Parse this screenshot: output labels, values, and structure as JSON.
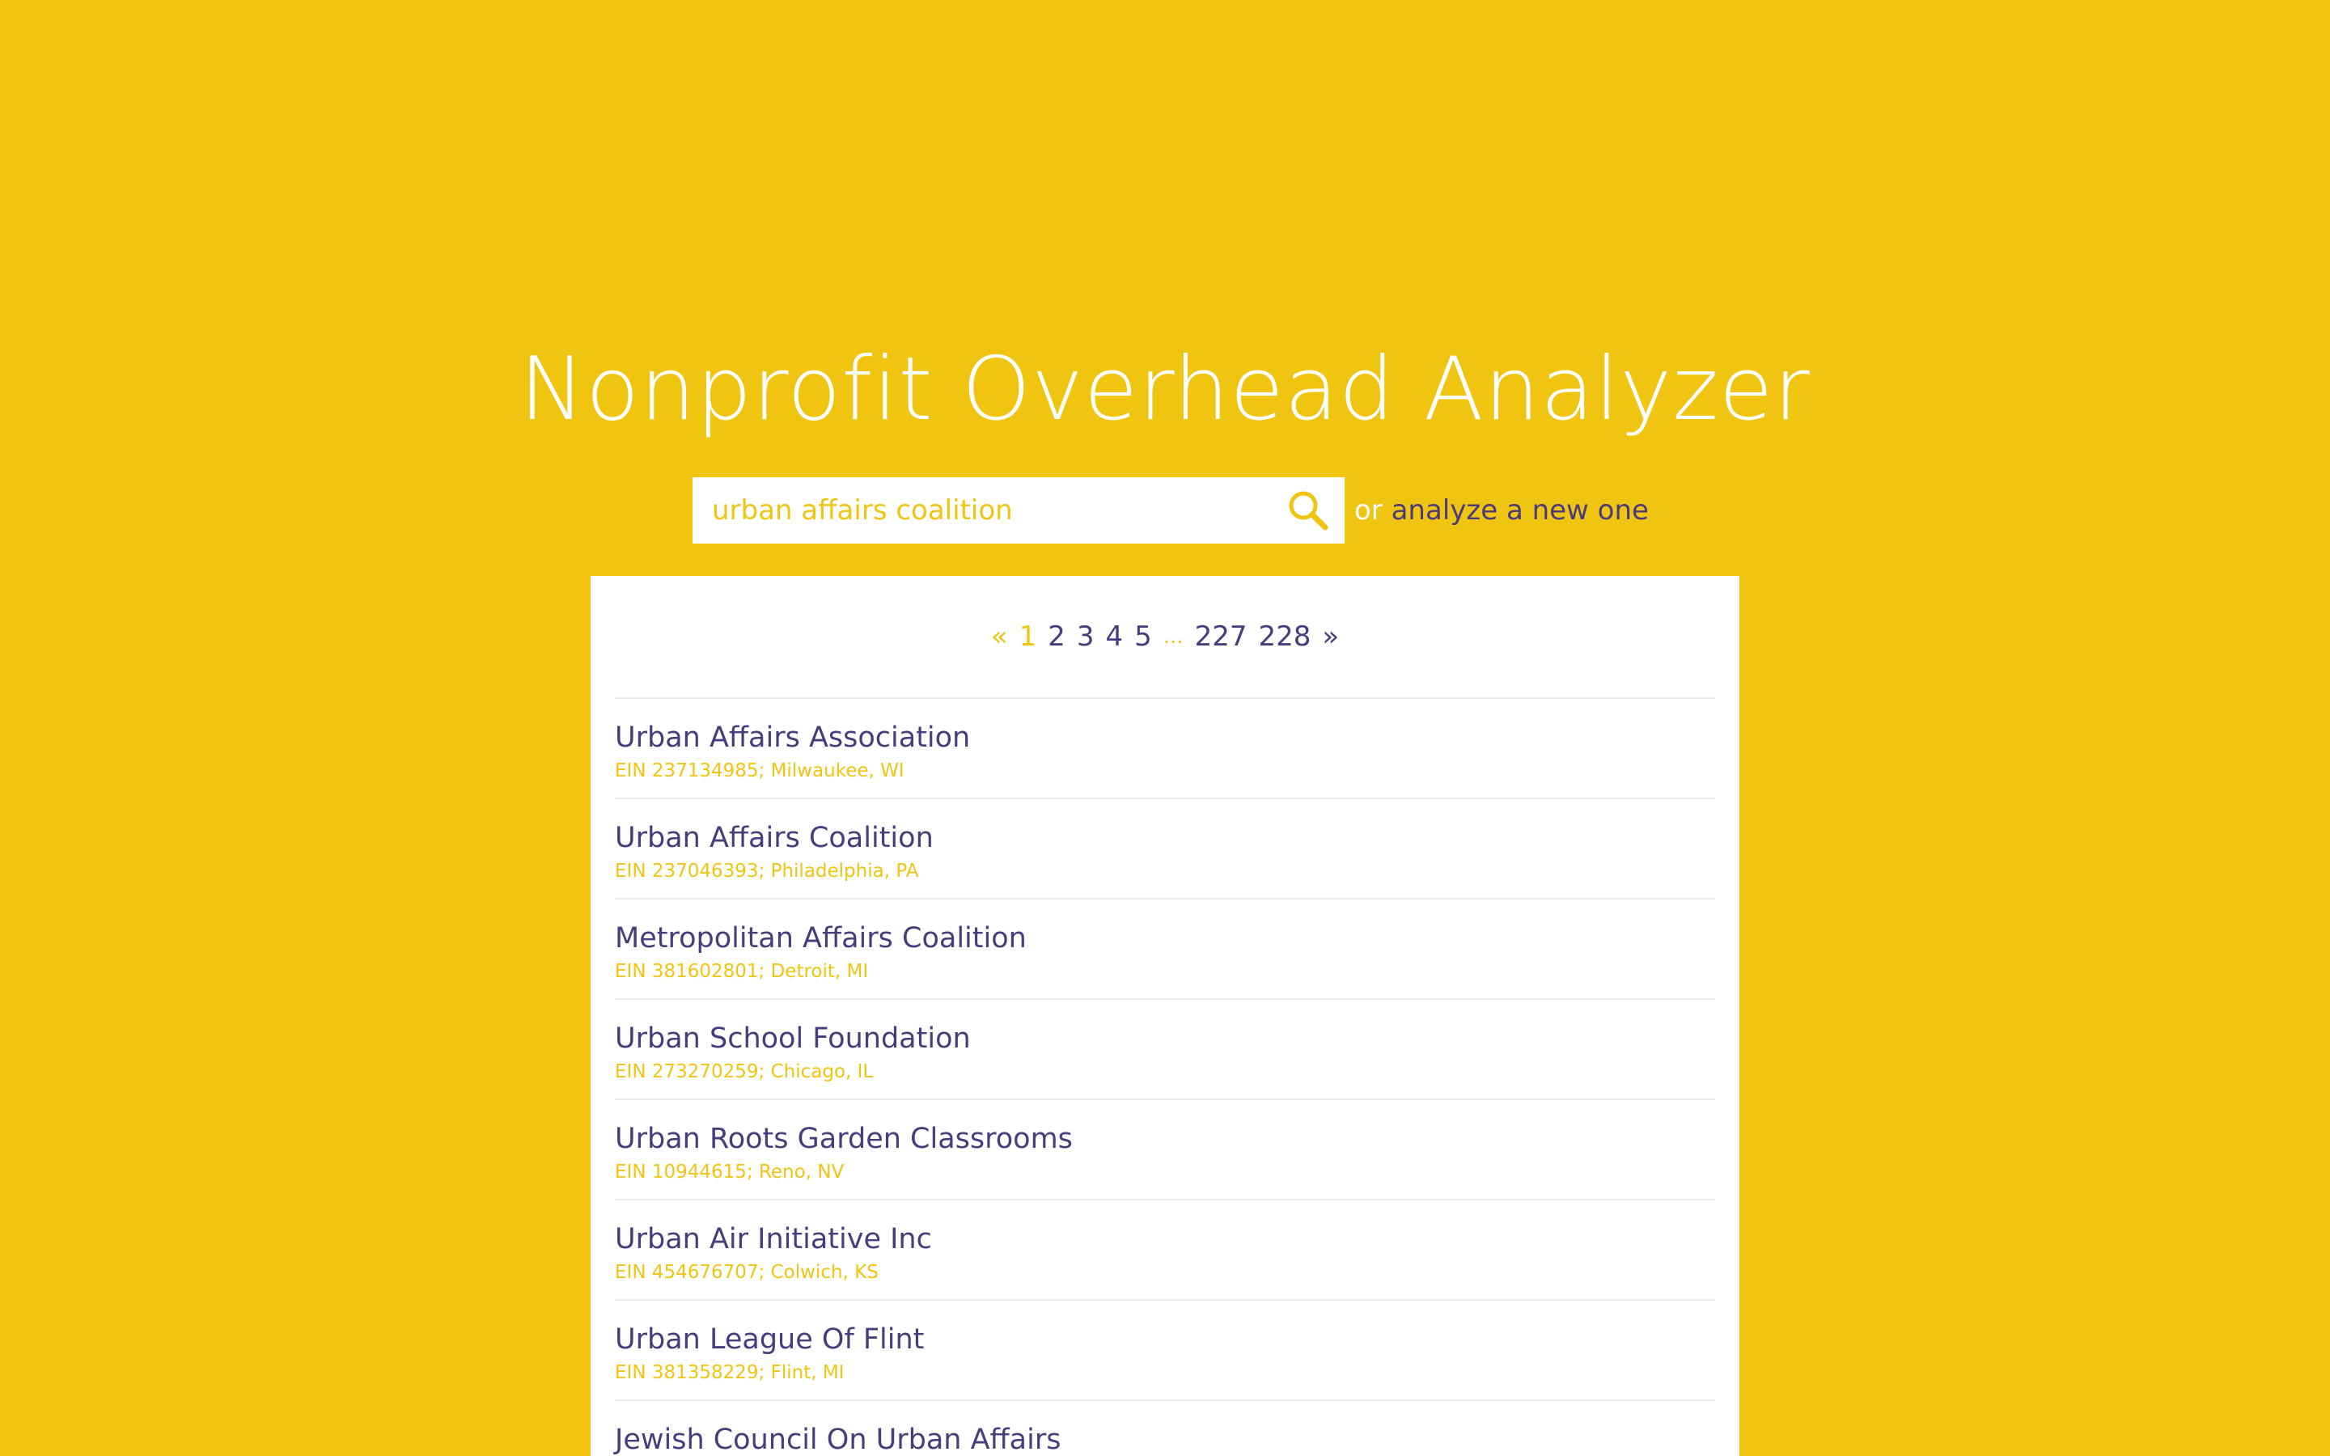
{
  "header": {
    "title": "Nonprofit Overhead Analyzer"
  },
  "search": {
    "value": "urban affairs coalition",
    "or_text": "or",
    "alt_link": "analyze a new one",
    "icon": "search-icon"
  },
  "pagination": {
    "prev": "«",
    "current": "1",
    "pages": [
      "2",
      "3",
      "4",
      "5"
    ],
    "ellipsis": "...",
    "last_pages": [
      "227",
      "228"
    ],
    "next": "»"
  },
  "results": [
    {
      "name": "Urban Affairs Association",
      "meta": "EIN 237134985; Milwaukee, WI"
    },
    {
      "name": "Urban Affairs Coalition",
      "meta": "EIN 237046393; Philadelphia, PA"
    },
    {
      "name": "Metropolitan Affairs Coalition",
      "meta": "EIN 381602801; Detroit, MI"
    },
    {
      "name": "Urban School Foundation",
      "meta": "EIN 273270259; Chicago, IL"
    },
    {
      "name": "Urban Roots Garden Classrooms",
      "meta": "EIN 10944615; Reno, NV"
    },
    {
      "name": "Urban Air Initiative Inc",
      "meta": "EIN 454676707; Colwich, KS"
    },
    {
      "name": "Urban League Of Flint",
      "meta": "EIN 381358229; Flint, MI"
    },
    {
      "name": "Jewish Council On Urban Affairs",
      "meta": ""
    }
  ],
  "colors": {
    "background": "#F0C512",
    "accent": "#4A3B7C",
    "panel": "#FFFFFF"
  }
}
